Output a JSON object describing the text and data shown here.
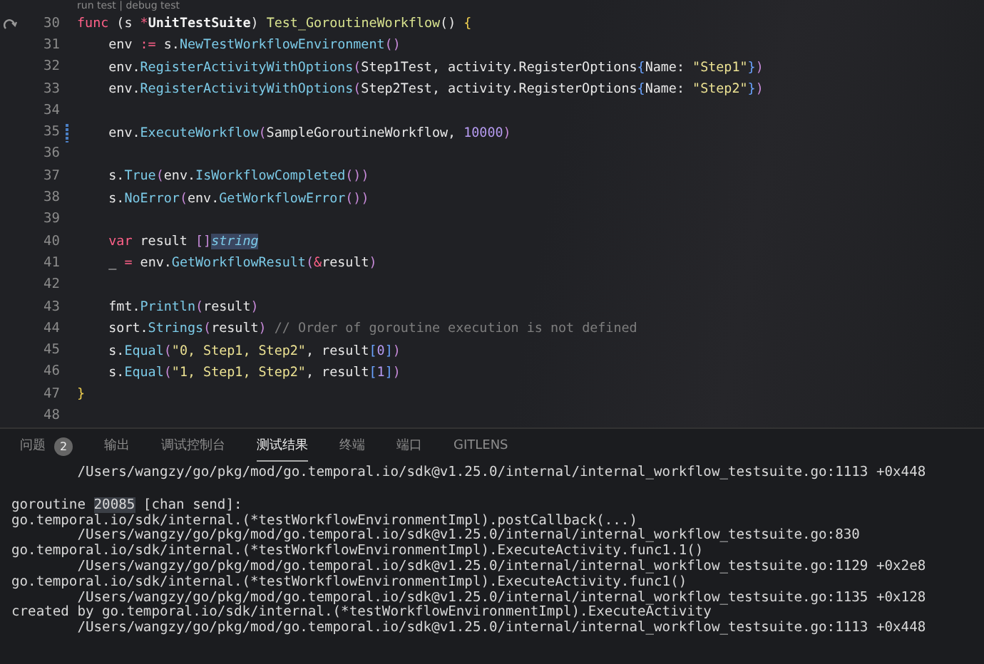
{
  "editor": {
    "codelens": "run test | debug test",
    "lines": [
      {
        "number": "30",
        "kind": "run",
        "tokens": [
          {
            "text": "func",
            "kind": "kw"
          },
          {
            "text": " (s ",
            "kind": "plain"
          },
          {
            "text": "*",
            "kind": "op"
          },
          {
            "text": "UnitTestSuite",
            "kind": "type"
          },
          {
            "text": ") ",
            "kind": "plain"
          },
          {
            "text": "Test_GoroutineWorkflow",
            "kind": "def"
          },
          {
            "text": "() ",
            "kind": "plain"
          },
          {
            "text": "{",
            "kind": "brace"
          }
        ]
      },
      {
        "number": "31",
        "indented": true,
        "tokens": [
          {
            "text": "env ",
            "kind": "plain"
          },
          {
            "text": ":=",
            "kind": "op"
          },
          {
            "text": " s.",
            "kind": "plain"
          },
          {
            "text": "NewTestWorkflowEnvironment",
            "kind": "call"
          },
          {
            "text": "()",
            "kind": "paren"
          }
        ]
      },
      {
        "number": "32",
        "indented": true,
        "tokens": [
          {
            "text": "env.",
            "kind": "plain"
          },
          {
            "text": "RegisterActivityWithOptions",
            "kind": "call"
          },
          {
            "text": "(",
            "kind": "paren"
          },
          {
            "text": "Step1Test, activity.RegisterOptions",
            "kind": "plain"
          },
          {
            "text": "{",
            "kind": "bracket"
          },
          {
            "text": "Name: ",
            "kind": "plain"
          },
          {
            "text": "\"Step1\"",
            "kind": "str"
          },
          {
            "text": "}",
            "kind": "bracket"
          },
          {
            "text": ")",
            "kind": "paren"
          }
        ]
      },
      {
        "number": "33",
        "indented": true,
        "tokens": [
          {
            "text": "env.",
            "kind": "plain"
          },
          {
            "text": "RegisterActivityWithOptions",
            "kind": "call"
          },
          {
            "text": "(",
            "kind": "paren"
          },
          {
            "text": "Step2Test, activity.RegisterOptions",
            "kind": "plain"
          },
          {
            "text": "{",
            "kind": "bracket"
          },
          {
            "text": "Name: ",
            "kind": "plain"
          },
          {
            "text": "\"Step2\"",
            "kind": "str"
          },
          {
            "text": "}",
            "kind": "bracket"
          },
          {
            "text": ")",
            "kind": "paren"
          }
        ]
      },
      {
        "number": "34"
      },
      {
        "number": "35",
        "kind": "modified",
        "indented": true,
        "tokens": [
          {
            "text": "env.",
            "kind": "plain"
          },
          {
            "text": "ExecuteWorkflow",
            "kind": "call"
          },
          {
            "text": "(",
            "kind": "paren"
          },
          {
            "text": "SampleGoroutineWorkflow, ",
            "kind": "plain"
          },
          {
            "text": "10000",
            "kind": "num"
          },
          {
            "text": ")",
            "kind": "paren"
          }
        ]
      },
      {
        "number": "36"
      },
      {
        "number": "37",
        "indented": true,
        "tokens": [
          {
            "text": "s.",
            "kind": "plain"
          },
          {
            "text": "True",
            "kind": "call"
          },
          {
            "text": "(",
            "kind": "paren"
          },
          {
            "text": "env.",
            "kind": "plain"
          },
          {
            "text": "IsWorkflowCompleted",
            "kind": "call"
          },
          {
            "text": "())",
            "kind": "paren"
          }
        ]
      },
      {
        "number": "38",
        "indented": true,
        "tokens": [
          {
            "text": "s.",
            "kind": "plain"
          },
          {
            "text": "NoError",
            "kind": "call"
          },
          {
            "text": "(",
            "kind": "paren"
          },
          {
            "text": "env.",
            "kind": "plain"
          },
          {
            "text": "GetWorkflowError",
            "kind": "call"
          },
          {
            "text": "())",
            "kind": "paren"
          }
        ]
      },
      {
        "number": "39"
      },
      {
        "number": "40",
        "indented": true,
        "tokens": [
          {
            "text": "var",
            "kind": "kw"
          },
          {
            "text": " result ",
            "kind": "plain"
          },
          {
            "text": "[]",
            "kind": "paren"
          },
          {
            "text": "string",
            "kind": "typei",
            "highlight": true
          }
        ]
      },
      {
        "number": "41",
        "indented": true,
        "tokens": [
          {
            "text": "_ ",
            "kind": "plain"
          },
          {
            "text": "=",
            "kind": "op"
          },
          {
            "text": " env.",
            "kind": "plain"
          },
          {
            "text": "GetWorkflowResult",
            "kind": "call"
          },
          {
            "text": "(",
            "kind": "paren"
          },
          {
            "text": "&",
            "kind": "op"
          },
          {
            "text": "result",
            "kind": "plain"
          },
          {
            "text": ")",
            "kind": "paren"
          }
        ]
      },
      {
        "number": "42"
      },
      {
        "number": "43",
        "indented": true,
        "tokens": [
          {
            "text": "fmt.",
            "kind": "plain"
          },
          {
            "text": "Println",
            "kind": "call"
          },
          {
            "text": "(",
            "kind": "paren"
          },
          {
            "text": "result",
            "kind": "plain"
          },
          {
            "text": ")",
            "kind": "paren"
          }
        ]
      },
      {
        "number": "44",
        "indented": true,
        "tokens": [
          {
            "text": "sort.",
            "kind": "plain"
          },
          {
            "text": "Strings",
            "kind": "call"
          },
          {
            "text": "(",
            "kind": "paren"
          },
          {
            "text": "result",
            "kind": "plain"
          },
          {
            "text": ")",
            "kind": "paren"
          },
          {
            "text": " // Order of goroutine execution is not defined",
            "kind": "cmt"
          }
        ]
      },
      {
        "number": "45",
        "indented": true,
        "tokens": [
          {
            "text": "s.",
            "kind": "plain"
          },
          {
            "text": "Equal",
            "kind": "call"
          },
          {
            "text": "(",
            "kind": "paren"
          },
          {
            "text": "\"0, Step1, Step2\"",
            "kind": "str"
          },
          {
            "text": ", result",
            "kind": "plain"
          },
          {
            "text": "[",
            "kind": "bracket"
          },
          {
            "text": "0",
            "kind": "num"
          },
          {
            "text": "]",
            "kind": "bracket"
          },
          {
            "text": ")",
            "kind": "paren"
          }
        ]
      },
      {
        "number": "46",
        "indented": true,
        "tokens": [
          {
            "text": "s.",
            "kind": "plain"
          },
          {
            "text": "Equal",
            "kind": "call"
          },
          {
            "text": "(",
            "kind": "paren"
          },
          {
            "text": "\"1, Step1, Step2\"",
            "kind": "str"
          },
          {
            "text": ", result",
            "kind": "plain"
          },
          {
            "text": "[",
            "kind": "bracket"
          },
          {
            "text": "1",
            "kind": "num"
          },
          {
            "text": "]",
            "kind": "bracket"
          },
          {
            "text": ")",
            "kind": "paren"
          }
        ]
      },
      {
        "number": "47",
        "tokens": [
          {
            "text": "}",
            "kind": "brace"
          }
        ]
      },
      {
        "number": "48"
      }
    ]
  },
  "panel": {
    "tabs": [
      {
        "label": "问题",
        "badge": "2",
        "selected": false
      },
      {
        "label": "输出",
        "selected": false
      },
      {
        "label": "调试控制台",
        "selected": false
      },
      {
        "label": "测试结果",
        "selected": true
      },
      {
        "label": "终端",
        "selected": false
      },
      {
        "label": "端口",
        "selected": false
      },
      {
        "label": "GITLENS",
        "selected": false
      }
    ],
    "output": [
      {
        "indented": true,
        "segments": [
          {
            "text": "/Users/wangzy/go/pkg/mod/go.temporal.io/sdk@v1.25.0/internal/internal_workflow_testsuite.go:1113 +0x448"
          }
        ]
      },
      {
        "gap_before": true,
        "segments": [
          {
            "text": "goroutine "
          },
          {
            "text": "20085",
            "highlight": true
          },
          {
            "text": " [chan send]:"
          }
        ]
      },
      {
        "segments": [
          {
            "text": "go.temporal.io/sdk/internal.(*testWorkflowEnvironmentImpl).postCallback(...)"
          }
        ]
      },
      {
        "indented": true,
        "segments": [
          {
            "text": "/Users/wangzy/go/pkg/mod/go.temporal.io/sdk@v1.25.0/internal/internal_workflow_testsuite.go:830"
          }
        ]
      },
      {
        "segments": [
          {
            "text": "go.temporal.io/sdk/internal.(*testWorkflowEnvironmentImpl).ExecuteActivity.func1.1()"
          }
        ]
      },
      {
        "indented": true,
        "segments": [
          {
            "text": "/Users/wangzy/go/pkg/mod/go.temporal.io/sdk@v1.25.0/internal/internal_workflow_testsuite.go:1129 +0x2e8"
          }
        ]
      },
      {
        "segments": [
          {
            "text": "go.temporal.io/sdk/internal.(*testWorkflowEnvironmentImpl).ExecuteActivity.func1()"
          }
        ]
      },
      {
        "indented": true,
        "segments": [
          {
            "text": "/Users/wangzy/go/pkg/mod/go.temporal.io/sdk@v1.25.0/internal/internal_workflow_testsuite.go:1135 +0x128"
          }
        ]
      },
      {
        "segments": [
          {
            "text": "created by go.temporal.io/sdk/internal.(*testWorkflowEnvironmentImpl).ExecuteActivity"
          }
        ]
      },
      {
        "indented": true,
        "segments": [
          {
            "text": "/Users/wangzy/go/pkg/mod/go.temporal.io/sdk@v1.25.0/internal/internal_workflow_testsuite.go:1113 +0x448"
          }
        ]
      }
    ]
  }
}
